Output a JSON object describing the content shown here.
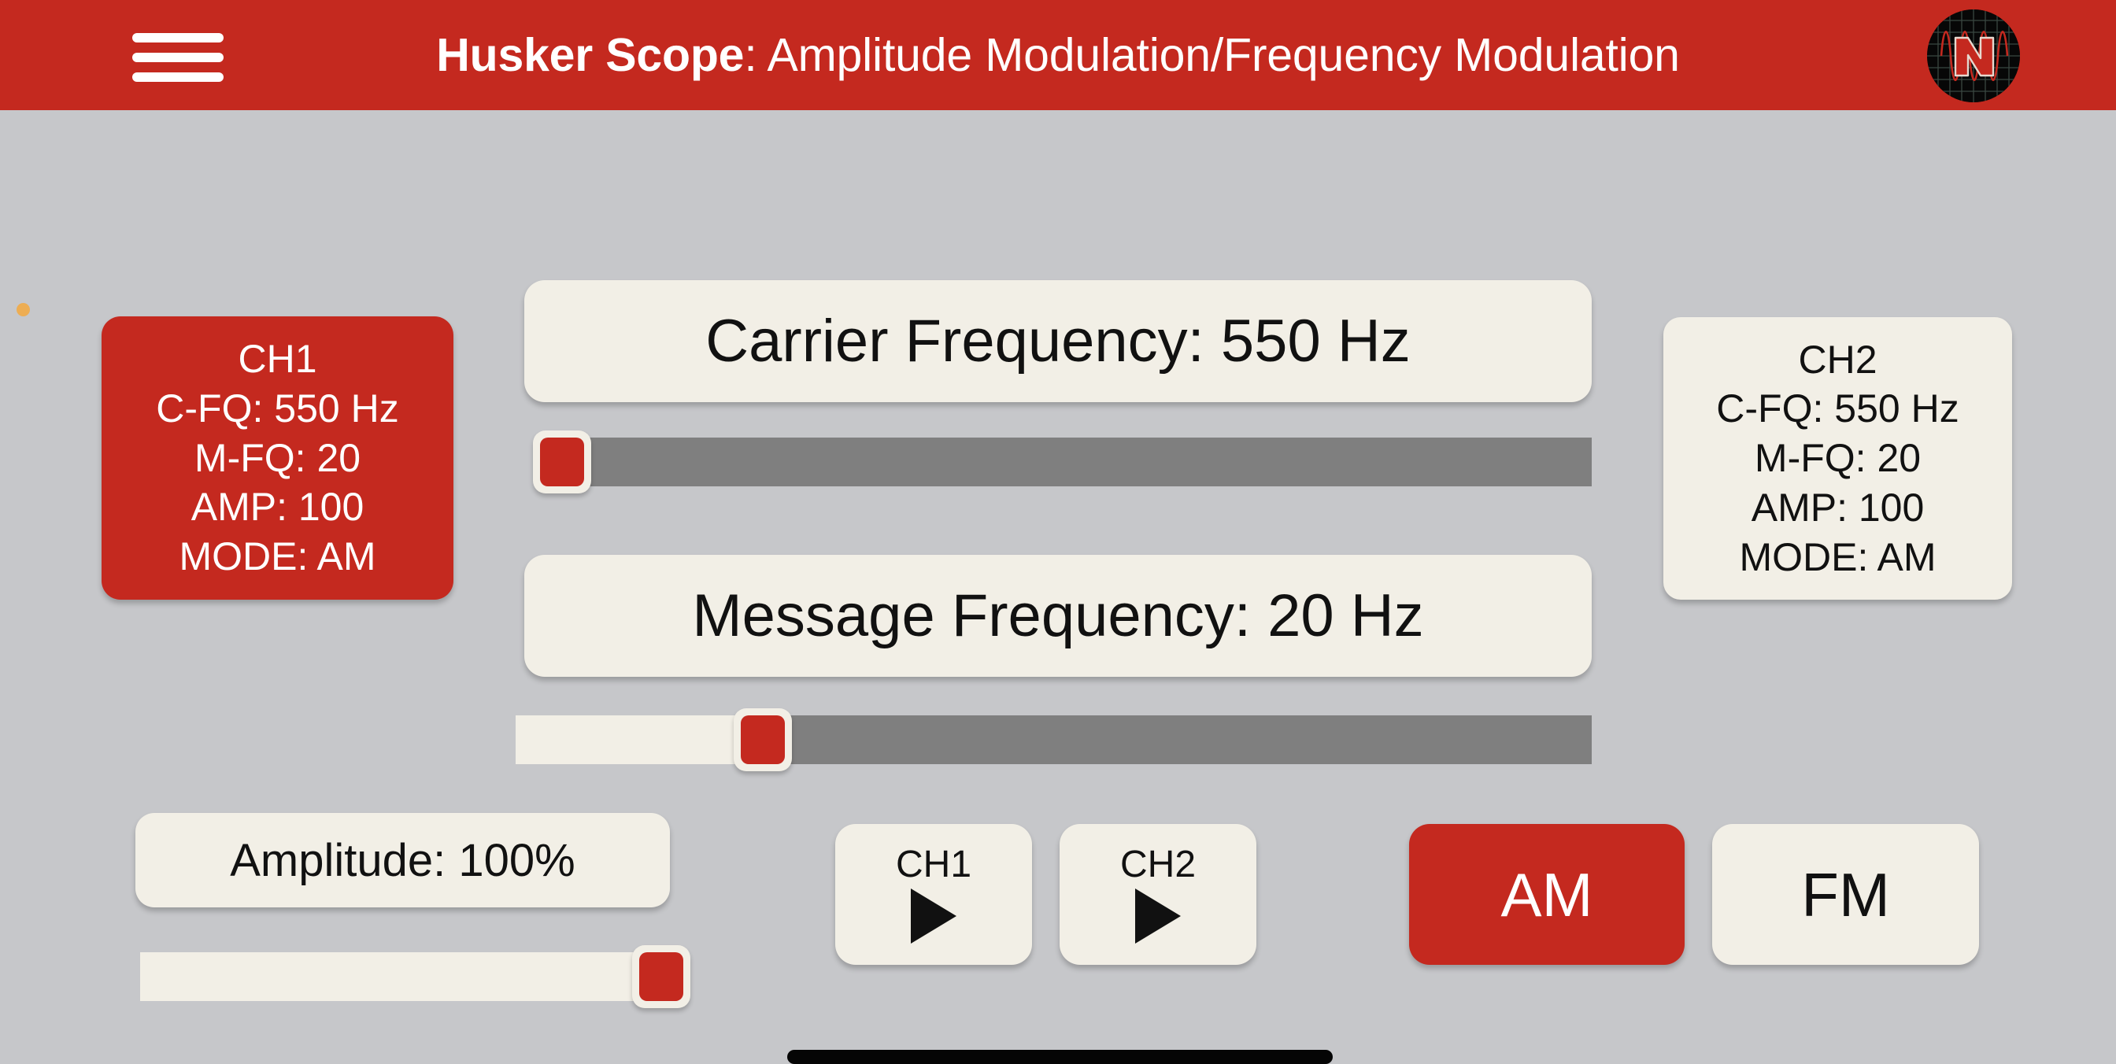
{
  "header": {
    "menu_icon": "hamburger-menu-icon",
    "title_strong": "Husker Scope",
    "title_normal": ": Amplitude Modulation/Frequency Modulation",
    "logo_icon": "husker-oscilloscope-logo"
  },
  "colors": {
    "brand_red": "#C4291F",
    "background_gray": "#C6C7CA",
    "card_cream": "#F2EFE6",
    "track_gray": "#7F7F7F",
    "text_dark": "#111111",
    "status_dot_orange": "#EDAD53",
    "logo_black": "#070707"
  },
  "status_dot": {
    "name": "status-indicator-dot"
  },
  "channels": {
    "ch1": {
      "title": "CH1",
      "carrier_frequency": "C-FQ: 550 Hz",
      "message_frequency": "M-FQ: 20",
      "amplitude": "AMP: 100",
      "mode": "MODE: AM",
      "active": true
    },
    "ch2": {
      "title": "CH2",
      "carrier_frequency": "C-FQ: 550 Hz",
      "message_frequency": "M-FQ: 20",
      "amplitude": "AMP: 100",
      "mode": "MODE: AM",
      "active": false
    }
  },
  "controls": {
    "carrier": {
      "readout": "Carrier Frequency: 550 Hz",
      "value": 550,
      "unit": "Hz",
      "fill_percent": 0
    },
    "message": {
      "readout": "Message Frequency: 20 Hz",
      "value": 20,
      "unit": "Hz",
      "fill_percent": 23
    },
    "amplitude": {
      "readout": "Amplitude: 100%",
      "value": 100,
      "unit": "%",
      "fill_percent": 100
    }
  },
  "buttons": {
    "ch1_play": {
      "label": "CH1",
      "icon": "play-triangle-icon"
    },
    "ch2_play": {
      "label": "CH2",
      "icon": "play-triangle-icon"
    },
    "am_mode": {
      "label": "AM",
      "selected": true
    },
    "fm_mode": {
      "label": "FM",
      "selected": false
    }
  },
  "system": {
    "home_indicator": "android-home-gesture-bar"
  }
}
